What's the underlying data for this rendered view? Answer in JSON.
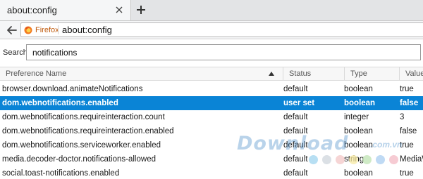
{
  "tab": {
    "title": "about:config"
  },
  "navbar": {
    "identity_label": "Firefox",
    "url": "about:config"
  },
  "search": {
    "label": "Search:",
    "value": "notifications"
  },
  "table": {
    "columns": [
      "Preference Name",
      "Status",
      "Type",
      "Value"
    ],
    "rows": [
      {
        "name": "browser.download.animateNotifications",
        "status": "default",
        "type": "boolean",
        "value": "true"
      },
      {
        "name": "dom.webnotifications.enabled",
        "status": "user set",
        "type": "boolean",
        "value": "false"
      },
      {
        "name": "dom.webnotifications.requireinteraction.count",
        "status": "default",
        "type": "integer",
        "value": "3"
      },
      {
        "name": "dom.webnotifications.requireinteraction.enabled",
        "status": "default",
        "type": "boolean",
        "value": "false"
      },
      {
        "name": "dom.webnotifications.serviceworker.enabled",
        "status": "default",
        "type": "boolean",
        "value": "true"
      },
      {
        "name": "media.decoder-doctor.notifications-allowed",
        "status": "default",
        "type": "string",
        "value": "MediaWMF"
      },
      {
        "name": "social.toast-notifications.enabled",
        "status": "default",
        "type": "boolean",
        "value": "true"
      }
    ]
  },
  "watermark": {
    "text": "Download",
    "suffix": ".com.vn"
  },
  "colors": {
    "selection": "#0a84d6",
    "dots": [
      "#9fd4ef",
      "#cfd6dc",
      "#f3c7c7",
      "#f7eaa3",
      "#bfe3b3",
      "#aacdf0",
      "#f3b9c4"
    ]
  },
  "icons": {
    "tab_close": "close-icon",
    "new_tab": "plus-icon",
    "back": "back-arrow-icon",
    "identity": "firefox-logo-icon",
    "sort": "sort-ascending-icon"
  }
}
